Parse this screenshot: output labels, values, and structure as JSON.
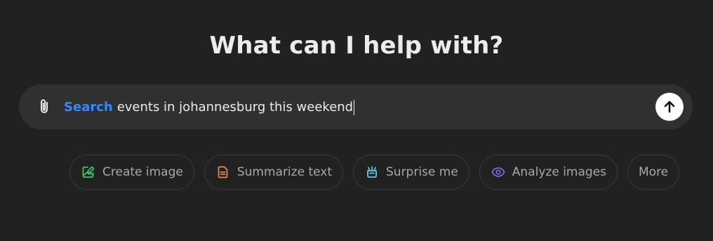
{
  "headline": "What can I help with?",
  "composer": {
    "search_label": "Search",
    "input_text": "events in johannesburg this weekend",
    "attach_icon": "paperclip-icon",
    "send_icon": "arrow-up-icon"
  },
  "chips": [
    {
      "label": "Create image",
      "icon": "image-edit-icon",
      "color": "#35c46a"
    },
    {
      "label": "Summarize text",
      "icon": "document-icon",
      "color": "#e8884a"
    },
    {
      "label": "Surprise me",
      "icon": "graduation-cap-icon",
      "color": "#5ec6e8"
    },
    {
      "label": "Analyze images",
      "icon": "eye-icon",
      "color": "#7a6ff0"
    },
    {
      "label": "More",
      "icon": "",
      "color": ""
    }
  ],
  "colors": {
    "background": "#212121",
    "composer": "#303030",
    "search_accent": "#2f8bff",
    "send_button": "#ffffff"
  }
}
